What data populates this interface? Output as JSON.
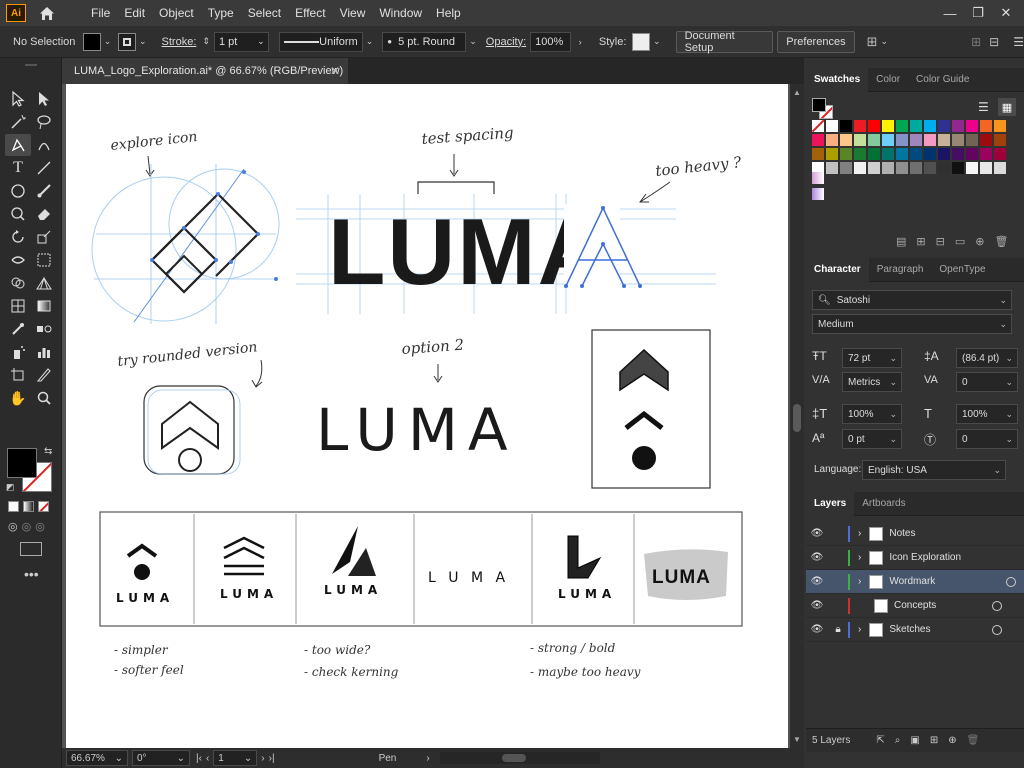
{
  "menubar": {
    "app_logo": "Ai",
    "items": [
      "File",
      "Edit",
      "Object",
      "Type",
      "Select",
      "Effect",
      "View",
      "Window",
      "Help"
    ]
  },
  "controlbar": {
    "selection": "No Selection",
    "stroke_label": "Stroke:",
    "stroke_weight": "1 pt",
    "stroke_profile": "Uniform",
    "brush": "5 pt. Round",
    "opacity_label": "Opacity:",
    "opacity_value": "100%",
    "style_label": "Style:",
    "doc_setup": "Document Setup",
    "preferences": "Preferences"
  },
  "document": {
    "tab_title": "LUMA_Logo_Exploration.ai* @ 66.67% (RGB/Preview)"
  },
  "statusbar": {
    "zoom": "66.67%",
    "rotation": "0°",
    "artboard": "1",
    "tool": "Pen"
  },
  "artwork": {
    "wordmark": "LUMA",
    "notes": {
      "explore_icon": "explore icon",
      "test_spacing": "test spacing",
      "too_heavy": "too heavy ?",
      "try_rounded": "try rounded version",
      "option2": "option 2",
      "simpler": "- simpler",
      "softer": "- softer feel",
      "too_wide": "- too wide?",
      "check_kerning": "- check kerning",
      "strong_bold": "- strong / bold",
      "maybe_heavy": "- maybe too heavy"
    },
    "concepts": [
      "LUMA",
      "LUMA",
      "LUMA",
      "L U M A",
      "LUMA",
      "LUMA"
    ]
  },
  "swatches_panel": {
    "tabs": [
      "Swatches",
      "Color",
      "Color Guide"
    ],
    "colors": [
      "#ffffff",
      "#ffffff",
      "#000000",
      "#ed1c24",
      "#ff0000",
      "#fff200",
      "#00a651",
      "#00a99d",
      "#00aeef",
      "#2e3192",
      "#92278f",
      "#ec008c",
      "#f26522",
      "#f7941d",
      "#ed145b",
      "#f9ad81",
      "#fdc689",
      "#c4df9b",
      "#82ca9c",
      "#6dcff6",
      "#8393ca",
      "#a186be",
      "#f49ac1",
      "#c7b299",
      "#998675",
      "#736357",
      "#9e0b0f",
      "#a0410d",
      "#a36209",
      "#aba000",
      "#598527",
      "#1a7b30",
      "#007236",
      "#00746b",
      "#0076a3",
      "#004a80",
      "#003471",
      "#1b1464",
      "#440e62",
      "#630460",
      "#9e005d",
      "#9e0039",
      "#ffffff",
      "#c0c0c0",
      "#808080",
      "#f0f0f0",
      "#d0d0d0",
      "#b0b0b0",
      "#909090",
      "#707070",
      "#505050",
      "#303030",
      "#101010",
      "#f7f7f7",
      "#e8e8e8",
      "#dcdcdc"
    ]
  },
  "character_panel": {
    "tabs": [
      "Character",
      "Paragraph",
      "OpenType"
    ],
    "font_family": "Satoshi",
    "font_style": "Medium",
    "font_size": "72 pt",
    "leading": "(86.4 pt)",
    "kerning": "Metrics",
    "tracking": "0",
    "vscale": "100%",
    "hscale": "100%",
    "baseline": "0 pt",
    "rotation": "0",
    "language_label": "Language:",
    "language": "English: USA"
  },
  "layers_panel": {
    "tabs": [
      "Layers",
      "Artboards"
    ],
    "layers": [
      {
        "name": "Notes",
        "color": "#4f6fd8"
      },
      {
        "name": "Icon Exploration",
        "color": "#3cb043"
      },
      {
        "name": "Wordmark",
        "color": "#3cb043"
      },
      {
        "name": "Concepts",
        "color": "#d03030"
      },
      {
        "name": "Sketches",
        "color": "#4f6fd8"
      }
    ],
    "count": "5 Layers"
  }
}
